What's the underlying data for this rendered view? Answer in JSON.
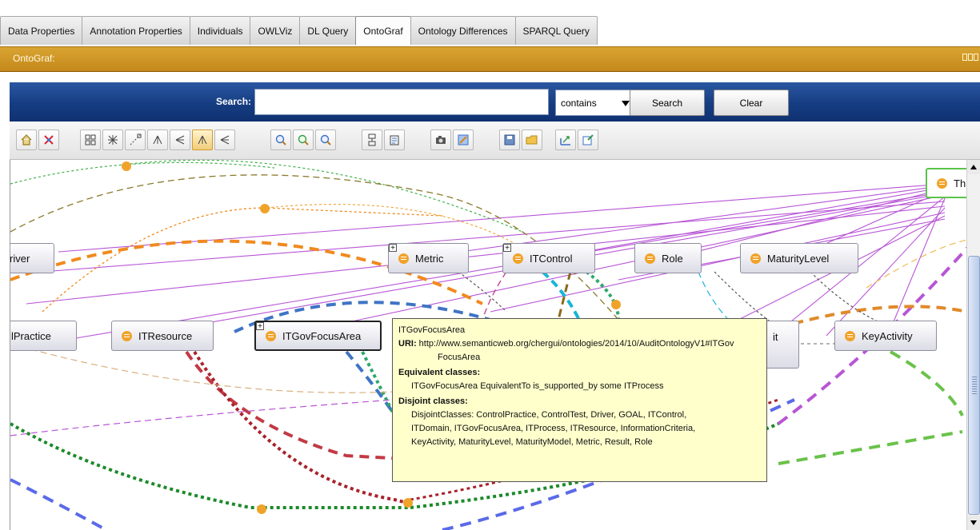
{
  "tabs": [
    {
      "label": "Data Properties",
      "active": false
    },
    {
      "label": "Annotation Properties",
      "active": false
    },
    {
      "label": "Individuals",
      "active": false
    },
    {
      "label": "OWLViz",
      "active": false
    },
    {
      "label": "DL Query",
      "active": false
    },
    {
      "label": "OntoGraf",
      "active": true
    },
    {
      "label": "Ontology Differences",
      "active": false
    },
    {
      "label": "SPARQL Query",
      "active": false
    }
  ],
  "view": {
    "title": "OntoGraf:"
  },
  "search": {
    "label": "Search:",
    "value": "",
    "match_mode": "contains",
    "search_button": "Search",
    "clear_button": "Clear"
  },
  "toolbar": {
    "icons": [
      "home-icon",
      "no-arrange-icon",
      "grid-layout-icon",
      "spring-layout-icon",
      "radial-layout-icon",
      "tree-down-icon",
      "tree-left-icon",
      "vertical-tree-icon",
      "horizontal-tree-icon",
      "zoom-in-icon",
      "zoom-fit-icon",
      "zoom-out-icon",
      "filter-nodes-icon",
      "filter-arcs-icon",
      "snapshot-icon",
      "configure-icon",
      "save-icon",
      "open-icon",
      "export-icon",
      "notes-icon"
    ],
    "active_icon": "vertical-tree-icon"
  },
  "graph": {
    "nodes": [
      {
        "label": "Driver",
        "shown": "river"
      },
      {
        "label": "Metric"
      },
      {
        "label": "ITControl"
      },
      {
        "label": "Role"
      },
      {
        "label": "MaturityLevel"
      },
      {
        "label": "ControlPractice",
        "shown": "lPractice"
      },
      {
        "label": "ITResource"
      },
      {
        "label": "ITGovFocusArea"
      },
      {
        "label": "KeyActivity"
      },
      {
        "label": "Thing",
        "shown": "Th"
      },
      {
        "label": "Result",
        "shown": "it"
      }
    ],
    "edge_colors": {
      "subclass": "#b855d6",
      "orange": "#f08a1e",
      "blue": "#3f74c4",
      "red": "#a8222b",
      "green": "#1c8a2a",
      "cyan": "#18b5d8",
      "olive": "#8a6a1a",
      "lightgreen": "#6ac24a",
      "salmon": "#e0a08a"
    }
  },
  "tooltip": {
    "title": "ITGovFocusArea",
    "uri_label": "URI:",
    "uri_line1": "http://www.semanticweb.org/chergui/ontologies/2014/10/AuditOntologyV1#ITGov",
    "uri_line2": "FocusArea",
    "equivalent_heading": "Equivalent classes:",
    "equivalent_text": "ITGovFocusArea EquivalentTo is_supported_by some ITProcess",
    "disjoint_heading": "Disjoint classes:",
    "disjoint_line1": "DisjointClasses: ControlPractice, ControlTest, Driver, GOAL, ITControl,",
    "disjoint_line2": "ITDomain, ITGovFocusArea, ITProcess, ITResource, InformationCriteria,",
    "disjoint_line3": "KeyActivity, MaturityLevel, MaturityModel, Metric, Result, Role"
  }
}
